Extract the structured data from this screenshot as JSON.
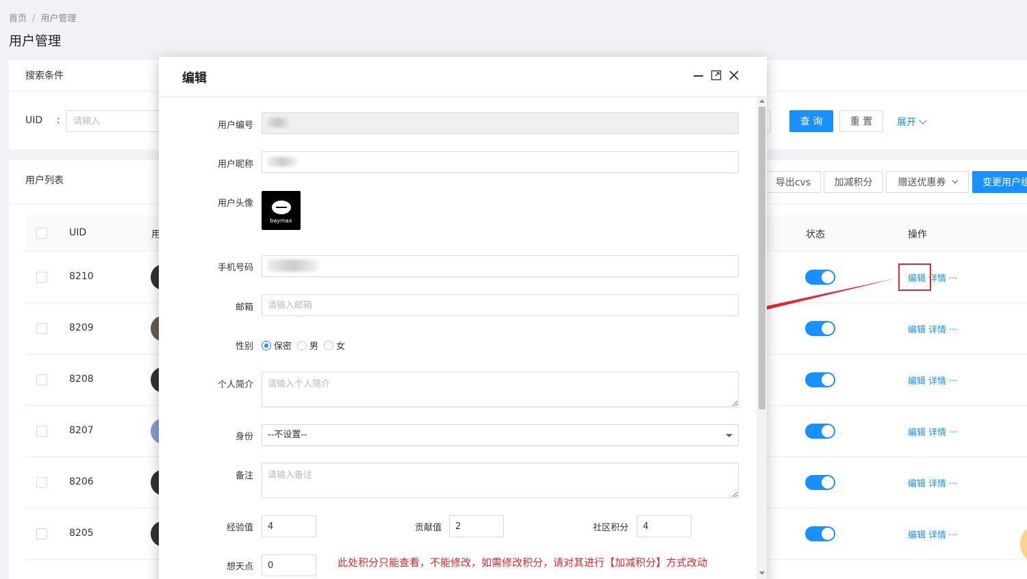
{
  "breadcrumb": {
    "home": "首页",
    "sep": "/",
    "current": "用户管理"
  },
  "page_title": "用户管理",
  "search": {
    "header": "搜索条件",
    "uid_label": "UID",
    "colon": ":",
    "uid_placeholder": "请输入",
    "query_label": "查 询",
    "reset_label": "重 置",
    "expand_label": "展开"
  },
  "list": {
    "header": "用户列表",
    "toolbar": {
      "export_label": "导出cvs",
      "points_label": "加减积分",
      "coupon_label": "赠送优惠券",
      "change_label": "变更用户组"
    },
    "columns": {
      "uid": "UID",
      "user": "用",
      "status": "状态",
      "ops": "操作"
    },
    "rows": [
      {
        "uid": "8210",
        "edit": "编辑",
        "detail": "详情",
        "more": "···"
      },
      {
        "uid": "8209",
        "edit": "编辑",
        "detail": "详情",
        "more": "···"
      },
      {
        "uid": "8208",
        "edit": "编辑",
        "detail": "详情",
        "more": "···"
      },
      {
        "uid": "8207",
        "edit": "编辑",
        "detail": "详情",
        "more": "···"
      },
      {
        "uid": "8206",
        "edit": "编辑",
        "detail": "详情",
        "more": "···"
      },
      {
        "uid": "8205",
        "edit": "编辑",
        "detail": "详情",
        "more": "···"
      }
    ]
  },
  "modal": {
    "title": "编辑",
    "avatar_logo_text": "baymax",
    "fields": {
      "user_id_label": "用户编号",
      "nickname_label": "用户昵称",
      "avatar_label": "用户头像",
      "phone_label": "手机号码",
      "email_label": "邮箱",
      "email_placeholder": "请输入邮箱",
      "gender_label": "性别",
      "gender_options": [
        "保密",
        "男",
        "女"
      ],
      "gender_selected": "保密",
      "bio_label": "个人简介",
      "bio_placeholder": "请输入个人简介",
      "identity_label": "身份",
      "identity_value": "--不设置--",
      "remark_label": "备注",
      "remark_placeholder": "请输入备注",
      "exp_label": "经验值",
      "exp_value": "4",
      "contrib_label": "贡献值",
      "contrib_value": "2",
      "community_label": "社区积分",
      "community_value": "4",
      "wish_label": "想天点",
      "wish_value": "0"
    },
    "notice": "此处积分只能查看，不能修改，如需修改积分，请对其进行【加减积分】方式改动"
  },
  "colors": {
    "primary": "#1890ff",
    "annotation": "#e8262b"
  }
}
